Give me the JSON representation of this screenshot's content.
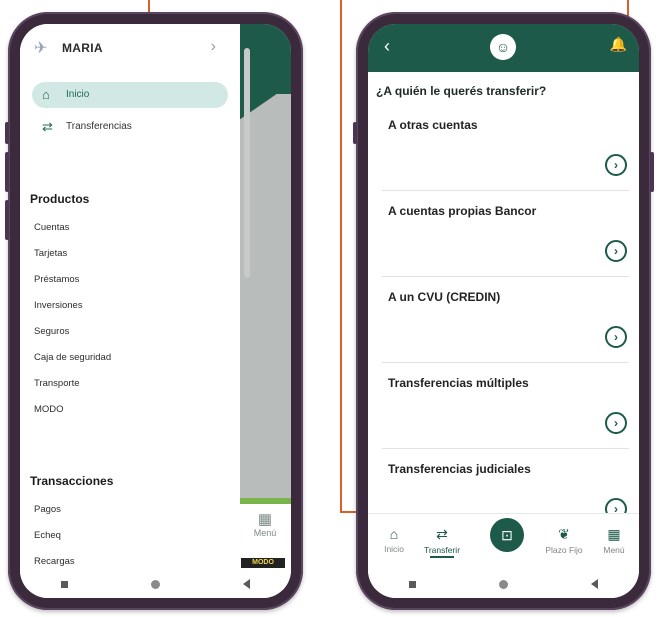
{
  "colors": {
    "callout": "#d9602a",
    "brand_green": "#1d5a4a",
    "active_bg": "#d2e8e4",
    "phone_frame": "#3b2a3c"
  },
  "left": {
    "user_name": "MARIA",
    "icons": {
      "logo": "bancor-logo",
      "chevron": "chevron-right-icon",
      "home": "home-icon",
      "transfer": "transfer-icon"
    },
    "nav": [
      {
        "label": "Inicio",
        "active": true
      },
      {
        "label": "Transferencias",
        "active": false
      }
    ],
    "productos_title": "Productos",
    "productos": [
      "Cuentas",
      "Tarjetas",
      "Préstamos",
      "Inversiones",
      "Seguros",
      "Caja de seguridad",
      "Transporte",
      "MODO"
    ],
    "transacciones_title": "Transacciones",
    "transacciones": [
      "Pagos",
      "Echeq",
      "Recargas"
    ],
    "behind": {
      "menu_label": "Menú",
      "modo_label": "MODO"
    }
  },
  "right": {
    "question": "¿A quién le querés transferir?",
    "options": [
      "A otras cuentas",
      "A cuentas propias Bancor",
      "A un CVU (CREDIN)",
      "Transferencias múltiples",
      "Transferencias judiciales"
    ],
    "bottom_nav": {
      "inicio": "Inicio",
      "transferir": "Transferir",
      "plazo_fijo": "Plazo Fijo",
      "menu": "Menú"
    }
  }
}
